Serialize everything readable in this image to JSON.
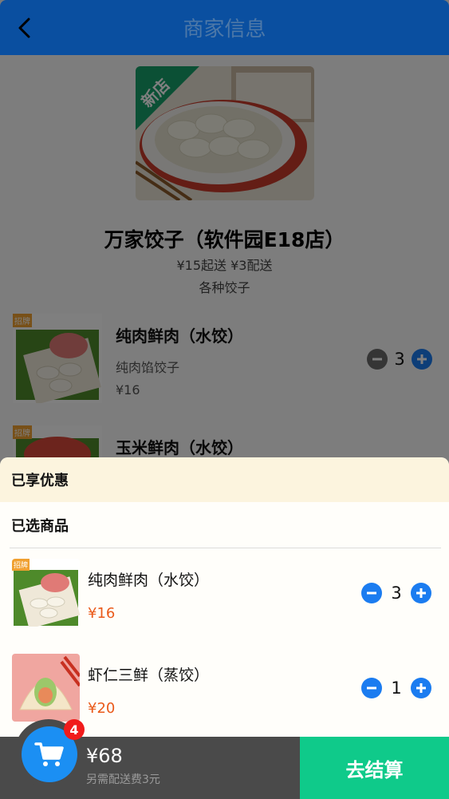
{
  "header": {
    "title": "商家信息"
  },
  "shop": {
    "hero_badge": "新店",
    "name": "万家饺子（软件园E18店）",
    "meta": "¥15起送 ¥3配送",
    "desc": "各种饺子"
  },
  "menu": [
    {
      "tag": "招牌",
      "name": "纯肉鲜肉（水饺）",
      "desc": "纯肉馅饺子",
      "price": "¥16",
      "qty": "3"
    },
    {
      "tag": "招牌",
      "name": "玉米鲜肉（水饺）"
    }
  ],
  "cart": {
    "promo_title": "已享优惠",
    "selected_title": "已选商品",
    "items": [
      {
        "tag": "招牌",
        "name": "纯肉鲜肉（水饺）",
        "price": "¥16",
        "qty": "3"
      },
      {
        "name": "虾仁三鲜（蒸饺）",
        "price": "¥20",
        "qty": "1"
      }
    ]
  },
  "bottom": {
    "badge_count": "4",
    "total": "¥68",
    "fee_note": "另需配送费3元",
    "checkout_label": "去结算"
  },
  "colors": {
    "brand": "#0a4fa0",
    "accent_blue": "#1b7cf0",
    "checkout": "#0fca8a",
    "price": "#ea5a1a",
    "badge": "#f11b1b"
  }
}
